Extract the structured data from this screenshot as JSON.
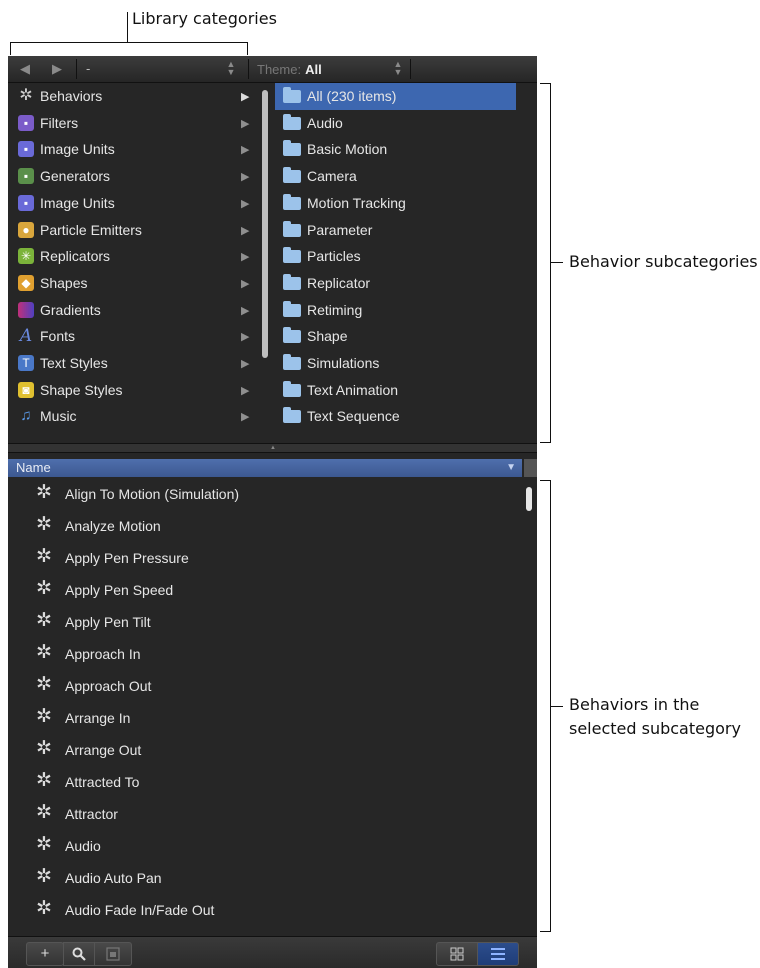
{
  "annotations": {
    "library_categories": "Library categories",
    "behavior_subcategories": "Behavior subcategories",
    "behaviors_line1": "Behaviors in the",
    "behaviors_line2": "selected subcategory"
  },
  "toolbar": {
    "back_icon": "left-triangle",
    "forward_icon": "right-triangle",
    "path_value": "-",
    "theme_label": "Theme:",
    "theme_value": "All"
  },
  "categories": [
    {
      "label": "Behaviors",
      "icon": "gear-icon",
      "color": "#c8c8c8",
      "selected": true
    },
    {
      "label": "Filters",
      "icon": "filters-icon",
      "color": "#7b5cc9"
    },
    {
      "label": "Image Units",
      "icon": "image-units-icon",
      "color": "#6a6ad8"
    },
    {
      "label": "Generators",
      "icon": "generators-icon",
      "color": "#5a8f4a"
    },
    {
      "label": "Image Units",
      "icon": "image-units-icon",
      "color": "#6a6ad8"
    },
    {
      "label": "Particle Emitters",
      "icon": "particle-emitter-icon",
      "color": "#d9a63c"
    },
    {
      "label": "Replicators",
      "icon": "replicator-icon",
      "color": "#7bb33a"
    },
    {
      "label": "Shapes",
      "icon": "shapes-icon",
      "color": "#e0a030"
    },
    {
      "label": "Gradients",
      "icon": "gradient-icon",
      "color": "#c0307a"
    },
    {
      "label": "Fonts",
      "icon": "font-a-icon",
      "color": "#5b7bd6"
    },
    {
      "label": "Text Styles",
      "icon": "text-style-icon",
      "color": "#4a78c8"
    },
    {
      "label": "Shape Styles",
      "icon": "shape-style-icon",
      "color": "#e0c030"
    },
    {
      "label": "Music",
      "icon": "music-note-icon",
      "color": "#4a8ad8"
    }
  ],
  "subcategories": [
    {
      "label": "All (230 items)",
      "selected": true
    },
    {
      "label": "Audio"
    },
    {
      "label": "Basic Motion"
    },
    {
      "label": "Camera"
    },
    {
      "label": "Motion Tracking"
    },
    {
      "label": "Parameter"
    },
    {
      "label": "Particles"
    },
    {
      "label": "Replicator"
    },
    {
      "label": "Retiming"
    },
    {
      "label": "Shape"
    },
    {
      "label": "Simulations"
    },
    {
      "label": "Text Animation"
    },
    {
      "label": "Text Sequence"
    }
  ],
  "list_header": {
    "label": "Name",
    "sort_icon": "down-triangle"
  },
  "behaviors": [
    "Align To Motion (Simulation)",
    "Analyze Motion",
    "Apply Pen Pressure",
    "Apply Pen Speed",
    "Apply Pen Tilt",
    "Approach In",
    "Approach Out",
    "Arrange In",
    "Arrange Out",
    "Attracted To",
    "Attractor",
    "Audio",
    "Audio Auto Pan",
    "Audio Fade In/Fade Out"
  ],
  "bottom_bar": {
    "add_icon": "+",
    "search_icon": "magnifier",
    "theme_icon": "folder-box",
    "view_icon_mode": "grid-icon",
    "view_list_mode": "list-icon",
    "active_view": "list"
  }
}
